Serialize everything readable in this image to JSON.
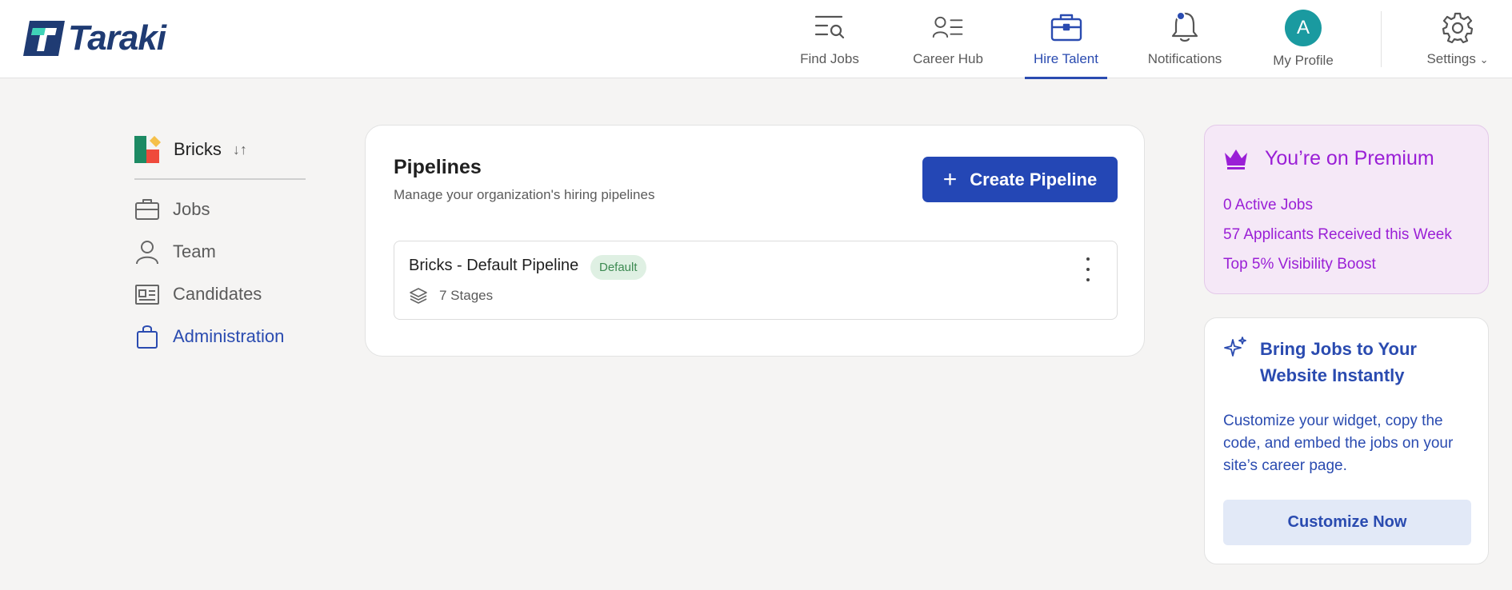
{
  "app": {
    "name": "Taraki"
  },
  "nav": {
    "items": [
      {
        "label": "Find Jobs",
        "icon": "find-jobs-icon",
        "active": false
      },
      {
        "label": "Career Hub",
        "icon": "career-hub-icon",
        "active": false
      },
      {
        "label": "Hire Talent",
        "icon": "briefcase-icon",
        "active": true
      },
      {
        "label": "Notifications",
        "icon": "bell-icon",
        "active": false
      },
      {
        "label": "My Profile",
        "icon": "avatar",
        "active": false
      },
      {
        "label": "Settings",
        "icon": "gear-icon",
        "active": false
      }
    ],
    "profile_initial": "A"
  },
  "sidebar": {
    "org_name": "Bricks",
    "items": [
      {
        "label": "Jobs",
        "icon": "briefcase-icon",
        "active": false
      },
      {
        "label": "Team",
        "icon": "user-icon",
        "active": false
      },
      {
        "label": "Candidates",
        "icon": "id-card-icon",
        "active": false
      },
      {
        "label": "Administration",
        "icon": "bag-icon",
        "active": true
      }
    ]
  },
  "pipelines": {
    "title": "Pipelines",
    "subtitle": "Manage your organization's hiring pipelines",
    "create_label": "Create Pipeline",
    "rows": [
      {
        "name": "Bricks - Default Pipeline",
        "badge": "Default",
        "stages": "7 Stages"
      }
    ]
  },
  "premium": {
    "title": "You’re on Premium",
    "lines": [
      "0 Active Jobs",
      "57 Applicants Received this Week",
      "Top 5% Visibility Boost"
    ]
  },
  "widget": {
    "title": "Bring Jobs to Your Website Instantly",
    "description": "Customize your widget, copy the code, and embed the jobs on your site’s career page.",
    "button_label": "Customize Now"
  },
  "colors": {
    "accent": "#2a4bb0",
    "premium": "#9a1fd6",
    "avatar": "#1a9aa0",
    "badge_bg": "#dff0e3"
  }
}
